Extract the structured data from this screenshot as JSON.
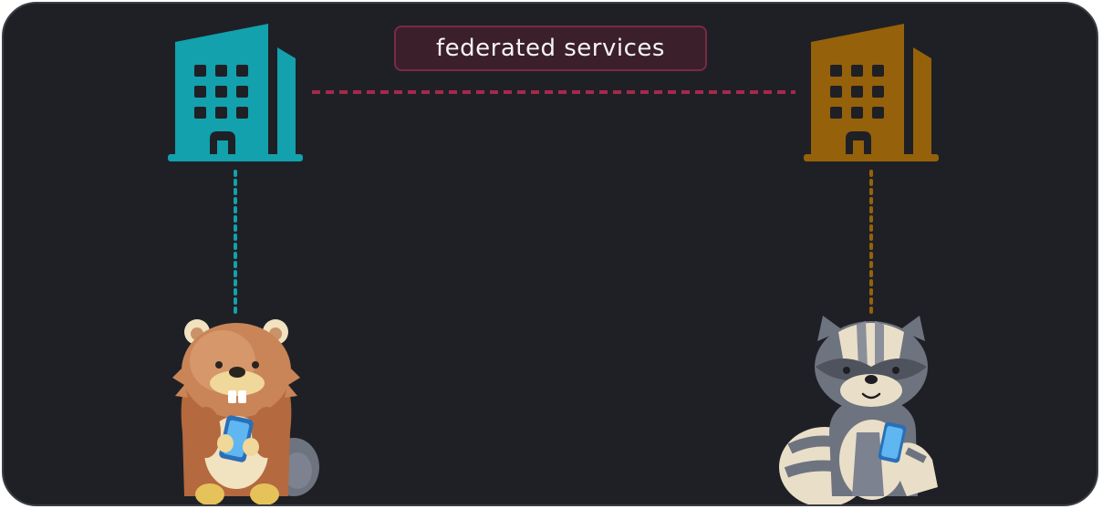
{
  "federation_label": "federated services",
  "colors": {
    "background": "#1f2025",
    "federation_link": "#a8284c",
    "server_left": "#12a1ad",
    "server_right": "#95610a"
  },
  "icons": {
    "server_left": "office-building-icon",
    "server_right": "office-building-icon",
    "user_left": "beaver-with-phone",
    "user_right": "raccoon-with-phone"
  }
}
